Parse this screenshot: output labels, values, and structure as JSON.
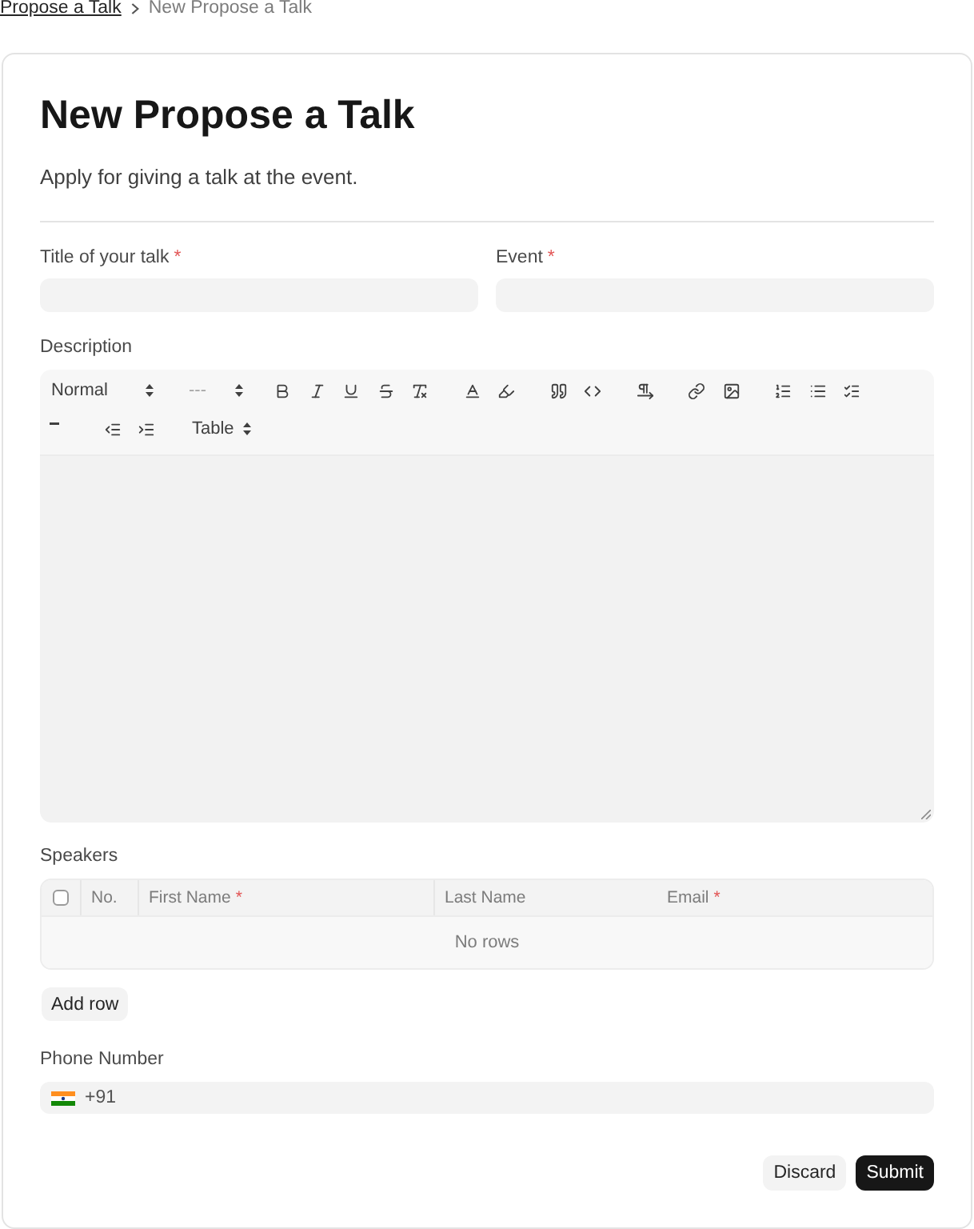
{
  "breadcrumb": [
    {
      "label": "Propose a Talk",
      "current": false
    },
    {
      "label": "New Propose a Talk",
      "current": true
    }
  ],
  "header": {
    "title": "New Propose a Talk",
    "subtitle": "Apply for giving a talk at the event."
  },
  "fields": [
    {
      "label": "Title of your talk",
      "required_mark": "*"
    },
    {
      "label": "Event",
      "required_mark": "*"
    }
  ],
  "description": {
    "label": "Description",
    "heading_select": {
      "value": "Normal"
    },
    "size_select": {
      "placeholder": "---"
    },
    "table_select": {
      "value": "Table"
    }
  },
  "speakers": {
    "label": "Speakers",
    "select_all": {
      "checked": false
    },
    "columns": [
      {
        "label": "No."
      },
      {
        "label": "First Name",
        "required_mark": "*"
      },
      {
        "label": "Last Name"
      },
      {
        "label": "Email",
        "required_mark": "*"
      }
    ],
    "empty_text": "No rows",
    "add_button": "Add row"
  },
  "phone": {
    "label": "Phone Number",
    "value": "+91"
  },
  "actions": [
    {
      "label": "Discard",
      "kind": "secondary"
    },
    {
      "label": "Submit",
      "kind": "primary"
    }
  ]
}
